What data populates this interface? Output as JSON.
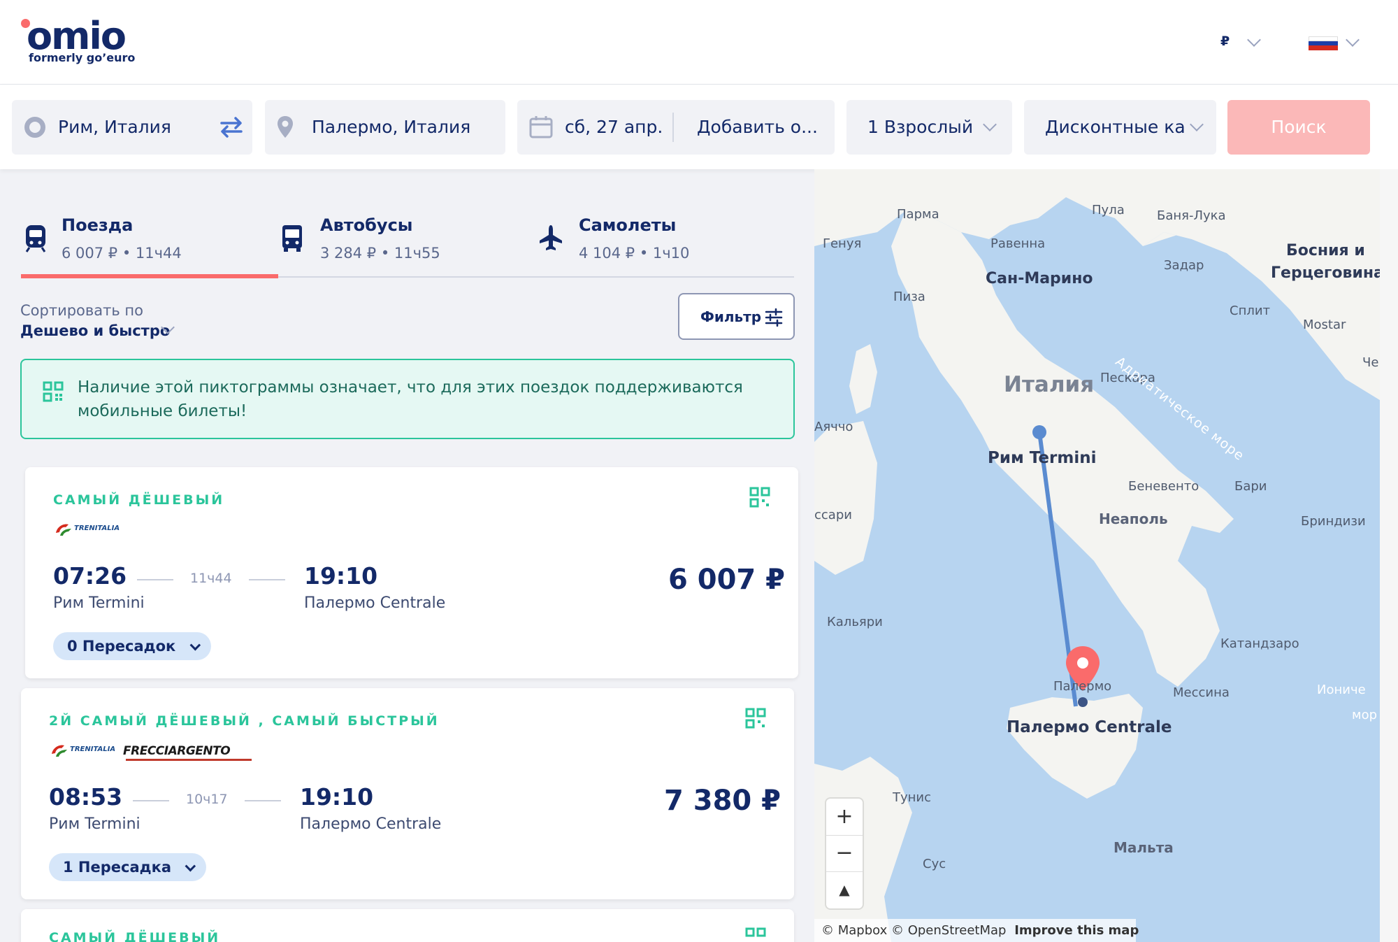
{
  "header": {
    "logo": "omio",
    "logo_sub": "formerly go’euro",
    "currency": "₽",
    "colors": {
      "accent": "#fa6b6b",
      "navy": "#132968",
      "green": "#2bc59b"
    }
  },
  "search": {
    "origin": "Рим, Италия",
    "destination": "Палермо, Италия",
    "date": "сб, 27 апр.",
    "return_placeholder": "Добавить о...",
    "passengers": "1 Взрослый",
    "discount_cards": "Дисконтные карт",
    "search_button": "Поиск"
  },
  "tabs": [
    {
      "label": "Поезда",
      "summary": "6 007 ₽ • 11ч44",
      "icon": "train-icon"
    },
    {
      "label": "Автобусы",
      "summary": "3 284 ₽ • 11ч55",
      "icon": "bus-icon"
    },
    {
      "label": "Самолеты",
      "summary": "4 104 ₽  • 1ч10",
      "icon": "plane-icon"
    }
  ],
  "sort": {
    "label": "Сортировать по",
    "value": "Дешево и быстро"
  },
  "filter_button": "Фильтр",
  "notice": "Наличие этой пиктограммы означает, что для этих поездок поддерживаются мобильные билеты!",
  "results": [
    {
      "label": "САМЫЙ ДЁШЕВЫЙ",
      "carriers": [
        "TRENITALIA"
      ],
      "departure_time": "07:26",
      "duration": "11ч44",
      "arrival_time": "19:10",
      "departure_station": "Рим Termini",
      "arrival_station": "Палермо Centrale",
      "price": "6 007 ₽",
      "transfers": "0 Пересадок"
    },
    {
      "label": "2Й САМЫЙ ДЁШЕВЫЙ , САМЫЙ БЫСТРЫЙ",
      "carriers": [
        "TRENITALIA",
        "FRECCIARGENTO"
      ],
      "departure_time": "08:53",
      "duration": "10ч17",
      "arrival_time": "19:10",
      "departure_station": "Рим Termini",
      "arrival_station": "Палермо Centrale",
      "price": "7 380 ₽",
      "transfers": "1 Пересадка"
    },
    {
      "label": "САМЫЙ ДЁШЕВЫЙ"
    }
  ],
  "map": {
    "labels": [
      "Парма",
      "Пула",
      "Баня-Лука",
      "Генуя",
      "Равенна",
      "Задар",
      "Пиза",
      "Сплит",
      "Mostar",
      "Чер",
      "Пескара",
      "Аяччо",
      "Беневенто",
      "Бари",
      "ссари",
      "Бриндизи",
      "Кальяри",
      "Катандзаро",
      "Мессина",
      "Иониче",
      "мор",
      "Тунис",
      "Сус",
      "Палермо"
    ],
    "major_labels": [
      "Сан-Марино",
      "Босния и",
      "Герцеговина",
      "Неаполь",
      "Мальта"
    ],
    "country": "Италия",
    "sea": "Адриатическое море",
    "origin_label": "Рим Termini",
    "destination_label": "Палермо Centrale",
    "zoom_in": "+",
    "zoom_out": "−",
    "compass": "▲",
    "attribution": "© Mapbox © OpenStreetMap",
    "improve": "Improve this map"
  }
}
